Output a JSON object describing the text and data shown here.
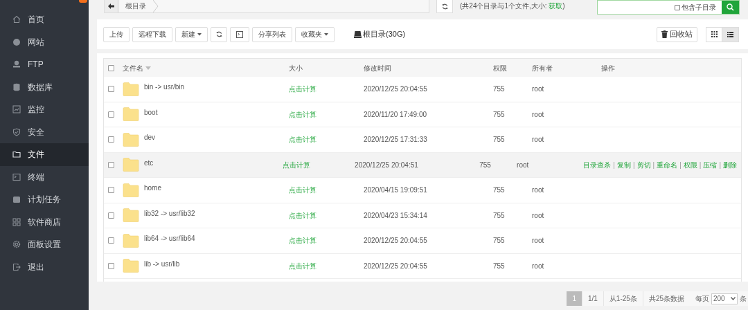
{
  "sidebar": {
    "items": [
      {
        "label": "首页",
        "selected": false
      },
      {
        "label": "网站",
        "selected": false
      },
      {
        "label": "FTP",
        "selected": false
      },
      {
        "label": "数据库",
        "selected": false
      },
      {
        "label": "监控",
        "selected": false
      },
      {
        "label": "安全",
        "selected": false
      },
      {
        "label": "文件",
        "selected": true
      },
      {
        "label": "终端",
        "selected": false
      },
      {
        "label": "计划任务",
        "selected": false
      },
      {
        "label": "软件商店",
        "selected": false
      },
      {
        "label": "面板设置",
        "selected": false
      },
      {
        "label": "退出",
        "selected": false
      }
    ]
  },
  "path_bar": {
    "breadcrumb": "根目录",
    "summary": "(共24个目录与1个文件,大小:",
    "summary_link": "获取",
    "summary_end": ")"
  },
  "search": {
    "include_subdirs_label": "包含子目录",
    "include_subdirs": false
  },
  "toolbar": {
    "buttons": [
      {
        "kind": "text",
        "label": "上传"
      },
      {
        "kind": "text",
        "label": "远程下载"
      },
      {
        "kind": "dropdown",
        "label": "新建"
      },
      {
        "kind": "refresh"
      },
      {
        "kind": "terminal"
      },
      {
        "kind": "text",
        "label": "分享列表"
      },
      {
        "kind": "dropdown",
        "label": "收藏夹"
      }
    ],
    "disk": "根目录(30G)",
    "recycle": "回收站",
    "view_buttons": [
      {
        "kind": "grid",
        "selected": false
      },
      {
        "kind": "list",
        "selected": true
      }
    ]
  },
  "table": {
    "select_all_checked": false,
    "action_separator": "|",
    "columns": [
      "文件名",
      "大小",
      "修改时间",
      "权限",
      "所有者",
      "操作"
    ],
    "rows": [
      {
        "name": "bin -> usr/bin",
        "size": "点击计算",
        "modified": "2020/12/25 20:04:55",
        "permission": "755",
        "owner": "root",
        "hovered": false
      },
      {
        "name": "boot",
        "size": "点击计算",
        "modified": "2020/11/20 17:49:00",
        "permission": "755",
        "owner": "root",
        "hovered": false
      },
      {
        "name": "dev",
        "size": "点击计算",
        "modified": "2020/12/25 17:31:33",
        "permission": "755",
        "owner": "root",
        "hovered": false
      },
      {
        "name": "etc",
        "size": "点击计算",
        "modified": "2020/12/25 20:04:51",
        "permission": "755",
        "owner": "root",
        "hovered": true,
        "actions": [
          "目录查杀",
          "复制",
          "剪切",
          "重命名",
          "权限",
          "压缩",
          "删除"
        ]
      },
      {
        "name": "home",
        "size": "点击计算",
        "modified": "2020/04/15 19:09:51",
        "permission": "755",
        "owner": "root",
        "hovered": false
      },
      {
        "name": "lib32 -> usr/lib32",
        "size": "点击计算",
        "modified": "2020/04/23 15:34:14",
        "permission": "755",
        "owner": "root",
        "hovered": false
      },
      {
        "name": "lib64 -> usr/lib64",
        "size": "点击计算",
        "modified": "2020/12/25 20:04:55",
        "permission": "755",
        "owner": "root",
        "hovered": false
      },
      {
        "name": "lib -> usr/lib",
        "size": "点击计算",
        "modified": "2020/12/25 20:04:55",
        "permission": "755",
        "owner": "root",
        "hovered": false
      }
    ]
  },
  "pagination": {
    "pages": [
      {
        "label": "1",
        "selected": true
      }
    ],
    "page_of": "1/1",
    "range": "从1-25条",
    "total": "共25条数据",
    "per_page_label": "每页",
    "per_page": "200",
    "unit": "条"
  }
}
